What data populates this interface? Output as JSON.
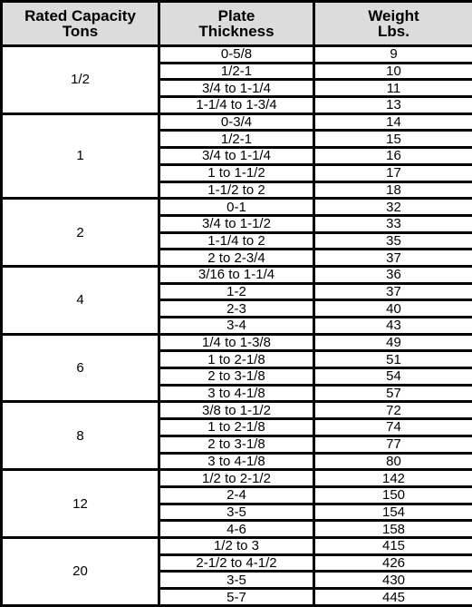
{
  "headers": [
    {
      "line1": "Rated Capacity",
      "line2": "Tons"
    },
    {
      "line1": "Plate",
      "line2": "Thickness"
    },
    {
      "line1": "Weight",
      "line2": "Lbs."
    }
  ],
  "groups": [
    {
      "capacity": "1/2",
      "rows": [
        {
          "thickness": "0-5/8",
          "weight": "9"
        },
        {
          "thickness": "1/2-1",
          "weight": "10"
        },
        {
          "thickness": "3/4 to 1-1/4",
          "weight": "11"
        },
        {
          "thickness": "1-1/4 to 1-3/4",
          "weight": "13"
        }
      ]
    },
    {
      "capacity": "1",
      "rows": [
        {
          "thickness": "0-3/4",
          "weight": "14"
        },
        {
          "thickness": "1/2-1",
          "weight": "15"
        },
        {
          "thickness": "3/4 to 1-1/4",
          "weight": "16"
        },
        {
          "thickness": "1 to 1-1/2",
          "weight": "17"
        },
        {
          "thickness": "1-1/2 to 2",
          "weight": "18"
        }
      ]
    },
    {
      "capacity": "2",
      "rows": [
        {
          "thickness": "0-1",
          "weight": "32"
        },
        {
          "thickness": "3/4 to 1-1/2",
          "weight": "33"
        },
        {
          "thickness": "1-1/4 to 2",
          "weight": "35"
        },
        {
          "thickness": "2 to 2-3/4",
          "weight": "37"
        }
      ]
    },
    {
      "capacity": "4",
      "rows": [
        {
          "thickness": "3/16 to 1-1/4",
          "weight": "36"
        },
        {
          "thickness": "1-2",
          "weight": "37"
        },
        {
          "thickness": "2-3",
          "weight": "40"
        },
        {
          "thickness": "3-4",
          "weight": "43"
        }
      ]
    },
    {
      "capacity": "6",
      "rows": [
        {
          "thickness": "1/4 to 1-3/8",
          "weight": "49"
        },
        {
          "thickness": "1 to 2-1/8",
          "weight": "51"
        },
        {
          "thickness": "2 to 3-1/8",
          "weight": "54"
        },
        {
          "thickness": "3 to 4-1/8",
          "weight": "57"
        }
      ]
    },
    {
      "capacity": "8",
      "rows": [
        {
          "thickness": "3/8 to 1-1/2",
          "weight": "72"
        },
        {
          "thickness": "1 to 2-1/8",
          "weight": "74"
        },
        {
          "thickness": "2 to 3-1/8",
          "weight": "77"
        },
        {
          "thickness": "3 to 4-1/8",
          "weight": "80"
        }
      ]
    },
    {
      "capacity": "12",
      "rows": [
        {
          "thickness": "1/2 to 2-1/2",
          "weight": "142"
        },
        {
          "thickness": "2-4",
          "weight": "150"
        },
        {
          "thickness": "3-5",
          "weight": "154"
        },
        {
          "thickness": "4-6",
          "weight": "158"
        }
      ]
    },
    {
      "capacity": "20",
      "rows": [
        {
          "thickness": "1/2 to 3",
          "weight": "415"
        },
        {
          "thickness": "2-1/2 to 4-1/2",
          "weight": "426"
        },
        {
          "thickness": "3-5",
          "weight": "430"
        },
        {
          "thickness": "5-7",
          "weight": "445"
        }
      ]
    }
  ]
}
